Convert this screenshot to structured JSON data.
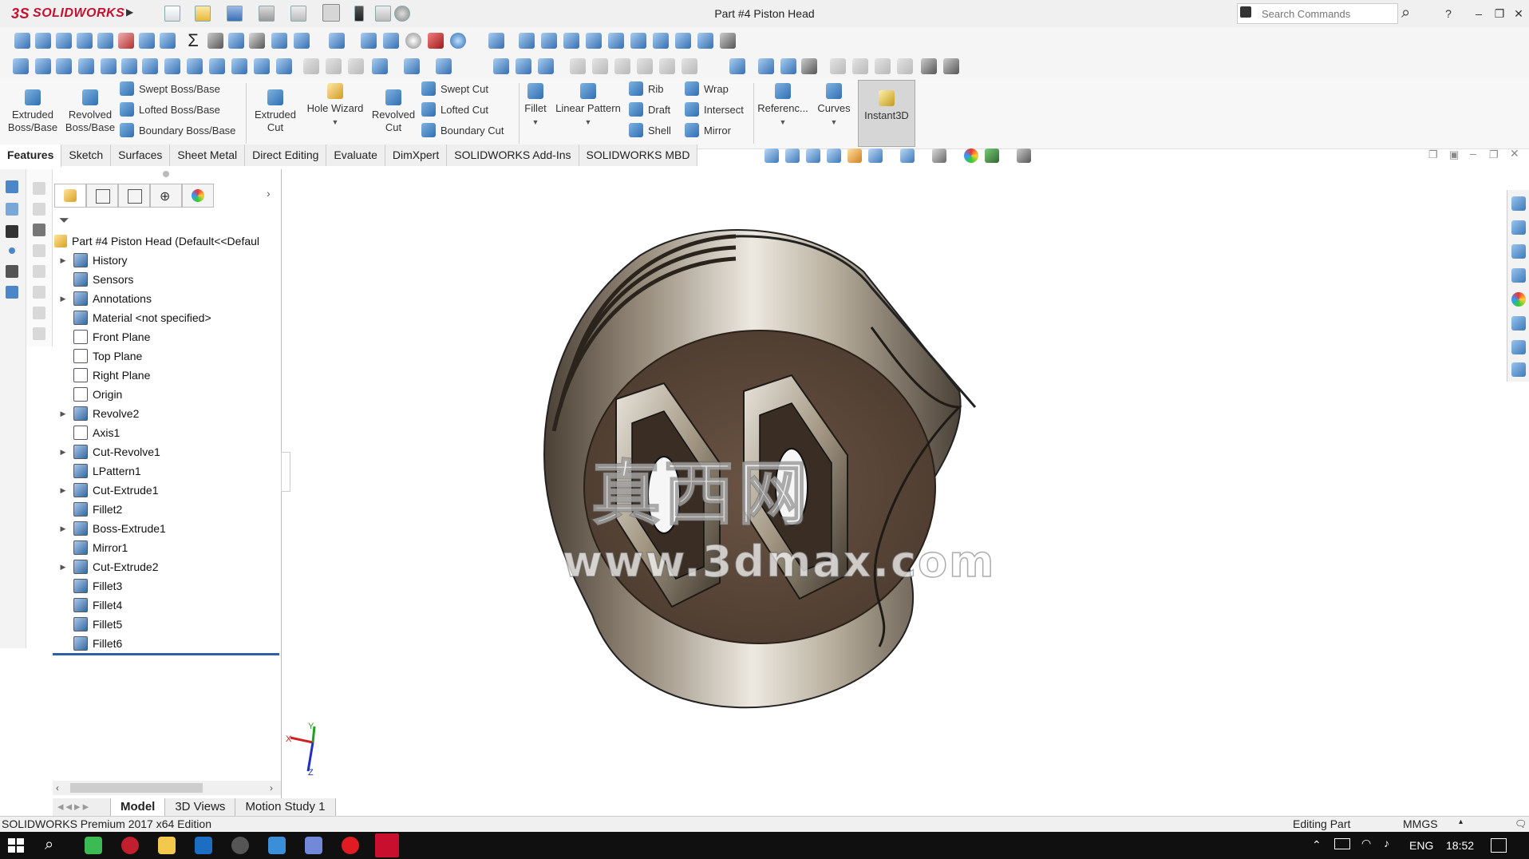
{
  "app": {
    "brand": "SOLIDWORKS",
    "brand_prefix": "3S",
    "window_title": "Part #4 Piston Head",
    "accent": "#c8102e"
  },
  "search": {
    "placeholder": "Search Commands"
  },
  "command_manager": {
    "extruded_boss": "Extruded Boss/Base",
    "revolved_boss": "Revolved Boss/Base",
    "swept_boss": "Swept Boss/Base",
    "lofted_boss": "Lofted Boss/Base",
    "boundary_boss": "Boundary Boss/Base",
    "extruded_cut": "Extruded Cut",
    "hole_wizard": "Hole Wizard",
    "revolved_cut": "Revolved Cut",
    "swept_cut": "Swept Cut",
    "lofted_cut": "Lofted Cut",
    "boundary_cut": "Boundary Cut",
    "fillet": "Fillet",
    "linear_pattern": "Linear Pattern",
    "rib": "Rib",
    "draft": "Draft",
    "shell": "Shell",
    "wrap": "Wrap",
    "intersect": "Intersect",
    "mirror": "Mirror",
    "reference": "Referenc...",
    "curves": "Curves",
    "instant3d": "Instant3D"
  },
  "tabs": [
    "Features",
    "Sketch",
    "Surfaces",
    "Sheet Metal",
    "Direct Editing",
    "Evaluate",
    "DimXpert",
    "SOLIDWORKS Add-Ins",
    "SOLIDWORKS MBD"
  ],
  "tree": {
    "root": "Part #4 Piston Head  (Default<<Defaul",
    "items": [
      {
        "label": "History",
        "expand": true,
        "icon": "history-icon"
      },
      {
        "label": "Sensors",
        "expand": false,
        "icon": "sensor-icon"
      },
      {
        "label": "Annotations",
        "expand": true,
        "icon": "annotation-icon"
      },
      {
        "label": "Material <not specified>",
        "expand": false,
        "icon": "material-icon"
      },
      {
        "label": "Front Plane",
        "expand": false,
        "icon": "plane-icon"
      },
      {
        "label": "Top Plane",
        "expand": false,
        "icon": "plane-icon"
      },
      {
        "label": "Right Plane",
        "expand": false,
        "icon": "plane-icon"
      },
      {
        "label": "Origin",
        "expand": false,
        "icon": "origin-icon"
      },
      {
        "label": "Revolve2",
        "expand": true,
        "icon": "revolve-icon"
      },
      {
        "label": "Axis1",
        "expand": false,
        "icon": "axis-icon"
      },
      {
        "label": "Cut-Revolve1",
        "expand": true,
        "icon": "cut-revolve-icon"
      },
      {
        "label": "LPattern1",
        "expand": false,
        "icon": "pattern-icon"
      },
      {
        "label": "Cut-Extrude1",
        "expand": true,
        "icon": "cut-extrude-icon"
      },
      {
        "label": "Fillet2",
        "expand": false,
        "icon": "fillet-icon"
      },
      {
        "label": "Boss-Extrude1",
        "expand": true,
        "icon": "boss-extrude-icon"
      },
      {
        "label": "Mirror1",
        "expand": false,
        "icon": "mirror-icon"
      },
      {
        "label": "Cut-Extrude2",
        "expand": true,
        "icon": "cut-extrude-icon"
      },
      {
        "label": "Fillet3",
        "expand": false,
        "icon": "fillet-icon"
      },
      {
        "label": "Fillet4",
        "expand": false,
        "icon": "fillet-icon"
      },
      {
        "label": "Fillet5",
        "expand": false,
        "icon": "fillet-icon"
      },
      {
        "label": "Fillet6",
        "expand": false,
        "icon": "fillet-icon"
      }
    ]
  },
  "bottom_tabs": [
    "Model",
    "3D Views",
    "Motion Study 1"
  ],
  "status": {
    "edition": "SOLIDWORKS Premium 2017 x64 Edition",
    "mode": "Editing Part",
    "units": "MMGS"
  },
  "triad": {
    "x": "X",
    "y": "Y",
    "z": "Z"
  },
  "watermark": {
    "line1": "真西网",
    "line2": "www.3dmax.com"
  },
  "taskbar": {
    "lang": "ENG",
    "time": "18:52"
  }
}
